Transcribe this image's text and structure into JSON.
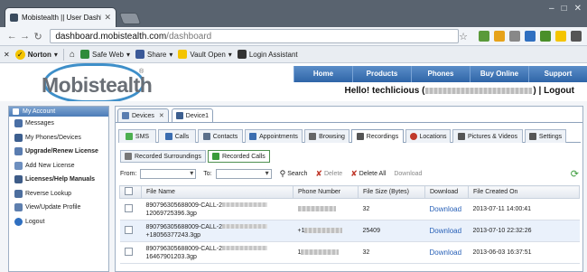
{
  "browser": {
    "tab_title": "Mobistealth || User Dashbo",
    "url_host": "dashboard.mobistealth.com",
    "url_path": "/dashboard"
  },
  "norton_toolbar": {
    "norton_label": "Norton",
    "safe_web_label": "Safe Web",
    "share_label": "Share",
    "vault_label": "Vault Open",
    "login_label": "Login Assistant"
  },
  "site": {
    "logo_text": "Mobistealth",
    "logo_mark": "®",
    "menu": [
      "Home",
      "Products",
      "Phones",
      "Buy Online",
      "Support"
    ],
    "greeting_prefix": "Hello!",
    "username": "techlicious",
    "greeting_paren_open": "(",
    "greeting_paren_close": ")",
    "separator": "|",
    "logout_label": "Logout"
  },
  "sidebar": {
    "header": "My Account",
    "items": [
      {
        "label": "Messages",
        "bold": false,
        "icon": "messages-icon",
        "color": "#4a6fa5"
      },
      {
        "label": "My Phones/Devices",
        "bold": false,
        "icon": "phone-icon",
        "color": "#3d5f8f"
      },
      {
        "label": "Upgrade/Renew License",
        "bold": true,
        "icon": "upgrade-icon",
        "color": "#5a7db0"
      },
      {
        "label": "Add New License",
        "bold": false,
        "icon": "license-icon",
        "color": "#6d8fbf"
      },
      {
        "label": "Licenses/Help Manuals",
        "bold": true,
        "icon": "manual-icon",
        "color": "#3e5c88"
      },
      {
        "label": "Reverse Lookup",
        "bold": false,
        "icon": "lookup-icon",
        "color": "#4c6e9e"
      },
      {
        "label": "View/Update Profile",
        "bold": false,
        "icon": "profile-icon",
        "color": "#5e7fae"
      },
      {
        "label": "Logout",
        "bold": false,
        "icon": "power-icon",
        "color": "#2f6fc0"
      }
    ]
  },
  "device_tabs": [
    {
      "label": "Devices",
      "active": false
    },
    {
      "label": "Device1",
      "active": true
    }
  ],
  "feature_tabs": [
    {
      "label": "SMS",
      "active": false,
      "color": "#4caf50"
    },
    {
      "label": "Calls",
      "active": false,
      "color": "#3b6db0"
    },
    {
      "label": "Contacts",
      "active": false,
      "color": "#5a6f8a"
    },
    {
      "label": "Appointments",
      "active": false,
      "color": "#3b6db0"
    },
    {
      "label": "Browsing",
      "active": false,
      "color": "#666"
    },
    {
      "label": "Recordings",
      "active": true,
      "color": "#555"
    },
    {
      "label": "Locations",
      "active": false,
      "color": "#c0392b"
    },
    {
      "label": "Pictures & Videos",
      "active": false,
      "color": "#555"
    },
    {
      "label": "Settings",
      "active": false,
      "color": "#555"
    }
  ],
  "sub_tabs": [
    {
      "label": "Recorded Surroundings",
      "active": false
    },
    {
      "label": "Recorded Calls",
      "active": true
    }
  ],
  "filters": {
    "from_label": "From:",
    "to_label": "To:",
    "search_label": "Search",
    "delete_label": "Delete",
    "delete_all_label": "Delete All",
    "download_label": "Download"
  },
  "table": {
    "headers": [
      "",
      "File Name",
      "Phone Number",
      "File Size (Bytes)",
      "Download",
      "File Created On"
    ],
    "rows": [
      {
        "file_line1": "890796305688009-CALL-2",
        "file_line2": "12069725396.3gp",
        "phone_prefix": "",
        "size": "32",
        "download": "Download",
        "created": "2013-07-11 14:00:41"
      },
      {
        "file_line1": "890796305688009-CALL-2",
        "file_line2": "+18056377243.3gp",
        "phone_prefix": "+1",
        "size": "25409",
        "download": "Download",
        "created": "2013-07-10 22:32:26"
      },
      {
        "file_line1": "890796305688009-CALL-2",
        "file_line2": "16467901203.3gp",
        "phone_prefix": "1",
        "size": "32",
        "download": "Download",
        "created": "2013-06-03 16:37:51"
      }
    ]
  },
  "colors": {
    "menu_bar": "#2f65a7",
    "link": "#2a62b8",
    "logo_ring": "#3e8fc9"
  }
}
